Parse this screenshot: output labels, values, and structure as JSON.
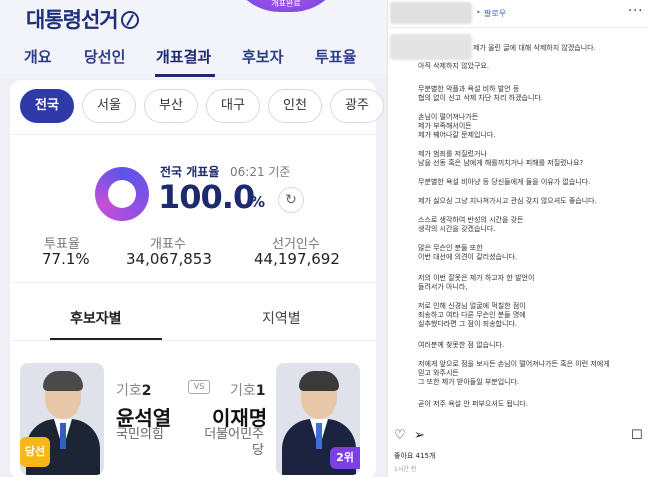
{
  "app": {
    "brand": "대통령선거",
    "banner_text": "개표완료",
    "nav": [
      "개요",
      "당선인",
      "개표결과",
      "후보자",
      "투표율"
    ],
    "regions": [
      "전국",
      "서울",
      "부산",
      "대구",
      "인천",
      "광주"
    ],
    "count": {
      "title": "전국 개표율",
      "time": "06:21 기준",
      "percent": "100.0",
      "unit": "%"
    },
    "stats": [
      {
        "label": "투표율",
        "value": "77.1%"
      },
      {
        "label": "개표수",
        "value": "34,067,853"
      },
      {
        "label": "선거인수",
        "value": "44,197,692"
      }
    ],
    "tabs": {
      "candidate": "후보자별",
      "region": "지역별"
    },
    "vs": "VS",
    "candidates": [
      {
        "no_label": "기호",
        "no": "2",
        "name": "윤석열",
        "party": "국민의힘",
        "badge": "당선"
      },
      {
        "no_label": "기호",
        "no": "1",
        "name": "이재명",
        "party_line1": "더불어민주",
        "party_line2": "당",
        "badge": "2위"
      }
    ]
  },
  "instagram": {
    "follow": "팔로우",
    "caption_lines": [
      "제가 올린 글에 대해 삭제하지 않겠습니다.",
      "아직 삭제하지 않았구요.",
      "무분별한 악플과 욕설 비하 발언 등",
      "협의 없이 신고 삭제 차단 처리 하겠습니다.",
      "손님이 떨어져나가든",
      "제가 부족해서이든",
      "제가 꿰어나갈 문제입니다.",
      "제가 범죄를 저질렀거나",
      "남을 선동 혹은 남에게 해를끼치거나 피해를 저질렀나요?",
      "무분별한 욕설 비아냥 등 당신들에게 들을 이유가 없습니다.",
      "제가 싫으심 그냥 지나쳐가시고 관심 갖지 않으셔도 좋습니다.",
      "스스로 생각하여 반성의 시간을 갖든",
      "생각의 시간을 갖겠습니다.",
      "많은 무슨인 분들 또한",
      "이번 대선에 의견이 갈리셨습니다.",
      "저의 이번 잘못은 제가 하고자 한 발언이",
      "돌려서가 아니라,",
      "저로 인해 신경님 얼굴에 먹칠한 점이",
      "죄송하고 여타 다른 무슨인 분들 명에",
      "실추했다라면 그 점이 죄송합니다.",
      "여러분께 찾못한 점 없습니다.",
      "저에게 앞으로 점을 보시든 손님이 떨어져나가든 혹은 이런 저에게",
      "믿고 와주시든",
      "그 또한 제가 받아들일 부분입니다.",
      "곧이 저주 욕설 안 퍼부으셔도 됩니다."
    ],
    "likes": "좋아요 415개",
    "ago": "1시간 전"
  }
}
